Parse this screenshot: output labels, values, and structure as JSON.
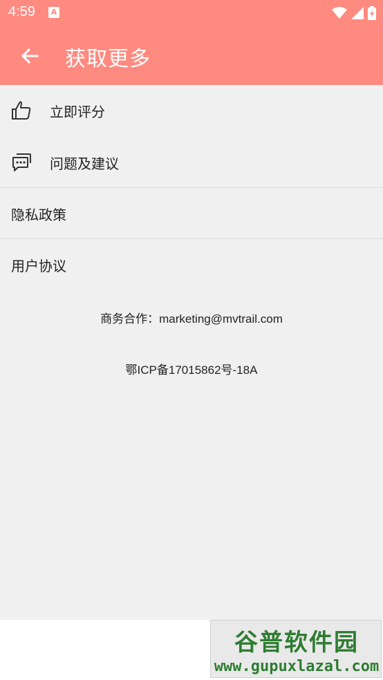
{
  "status_bar": {
    "time": "4:59",
    "notification_icon": "A"
  },
  "toolbar": {
    "title": "获取更多"
  },
  "menu": {
    "items": [
      {
        "label": "立即评分",
        "icon": "thumbs-up-icon"
      },
      {
        "label": "问题及建议",
        "icon": "feedback-chat-icon"
      },
      {
        "label": "隐私政策"
      },
      {
        "label": "用户协议"
      }
    ]
  },
  "info": {
    "business_label": "商务合作：",
    "business_email": "marketing@mvtrail.com",
    "icp": "鄂ICP备17015862号-18A"
  },
  "watermark": {
    "name": "谷普软件园",
    "url": "www.gupuxlazal.com"
  },
  "colors": {
    "header": "#ff8a80",
    "background": "#f0f0f0"
  }
}
